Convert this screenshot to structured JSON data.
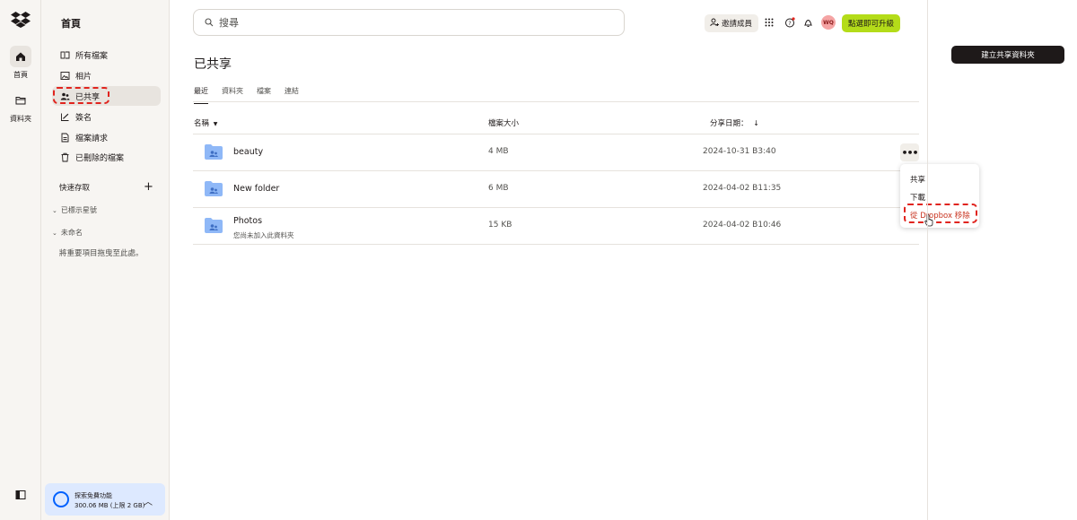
{
  "rail": {
    "items": [
      {
        "label": "首頁",
        "icon": "home-icon"
      },
      {
        "label": "資料夾",
        "icon": "folder-icon"
      }
    ]
  },
  "sidebar": {
    "title": "首頁",
    "items": [
      {
        "label": "所有檔案",
        "icon": "files-icon"
      },
      {
        "label": "相片",
        "icon": "photo-icon"
      },
      {
        "label": "已共享",
        "icon": "shared-icon"
      },
      {
        "label": "簽名",
        "icon": "signature-icon"
      },
      {
        "label": "檔案請求",
        "icon": "file-request-icon"
      },
      {
        "label": "已刪除的檔案",
        "icon": "trash-icon"
      }
    ],
    "quick_access": "快速存取",
    "starred": "已標示星號",
    "untitled": "未命名",
    "hint": "將重要項目拖曳至此處。",
    "storage": {
      "title": "探索免費功能",
      "usage": "300.06 MB (上限 2 GB)"
    }
  },
  "header": {
    "search_placeholder": "搜尋",
    "invite_label": "邀請成員",
    "avatar_initials": "WQ",
    "upgrade_label": "點選即可升級"
  },
  "main": {
    "title": "已共享",
    "tabs": [
      "最近",
      "資料夾",
      "檔案",
      "連結"
    ],
    "columns": {
      "name": "名稱",
      "size": "檔案大小",
      "date": "分享日期："
    },
    "rows": [
      {
        "name": "beauty",
        "sub": "",
        "size": "4 MB",
        "date": "2024-10-31 B3:40"
      },
      {
        "name": "New folder",
        "sub": "",
        "size": "6 MB",
        "date": "2024-04-02 B11:35"
      },
      {
        "name": "Photos",
        "sub": "您尚未加入此資料夾",
        "size": "15 KB",
        "date": "2024-04-02 B10:46"
      }
    ],
    "more_label": "•••"
  },
  "context_menu": {
    "items": [
      "共享",
      "下載",
      "從 Dropbox 移除"
    ]
  },
  "right_panel": {
    "create_label": "建立共享資料夾"
  },
  "colors": {
    "accent_green": "#b4dc19",
    "highlight_red": "#e0241e",
    "folder_blue": "#8fb8f7",
    "danger": "#c8321e"
  }
}
